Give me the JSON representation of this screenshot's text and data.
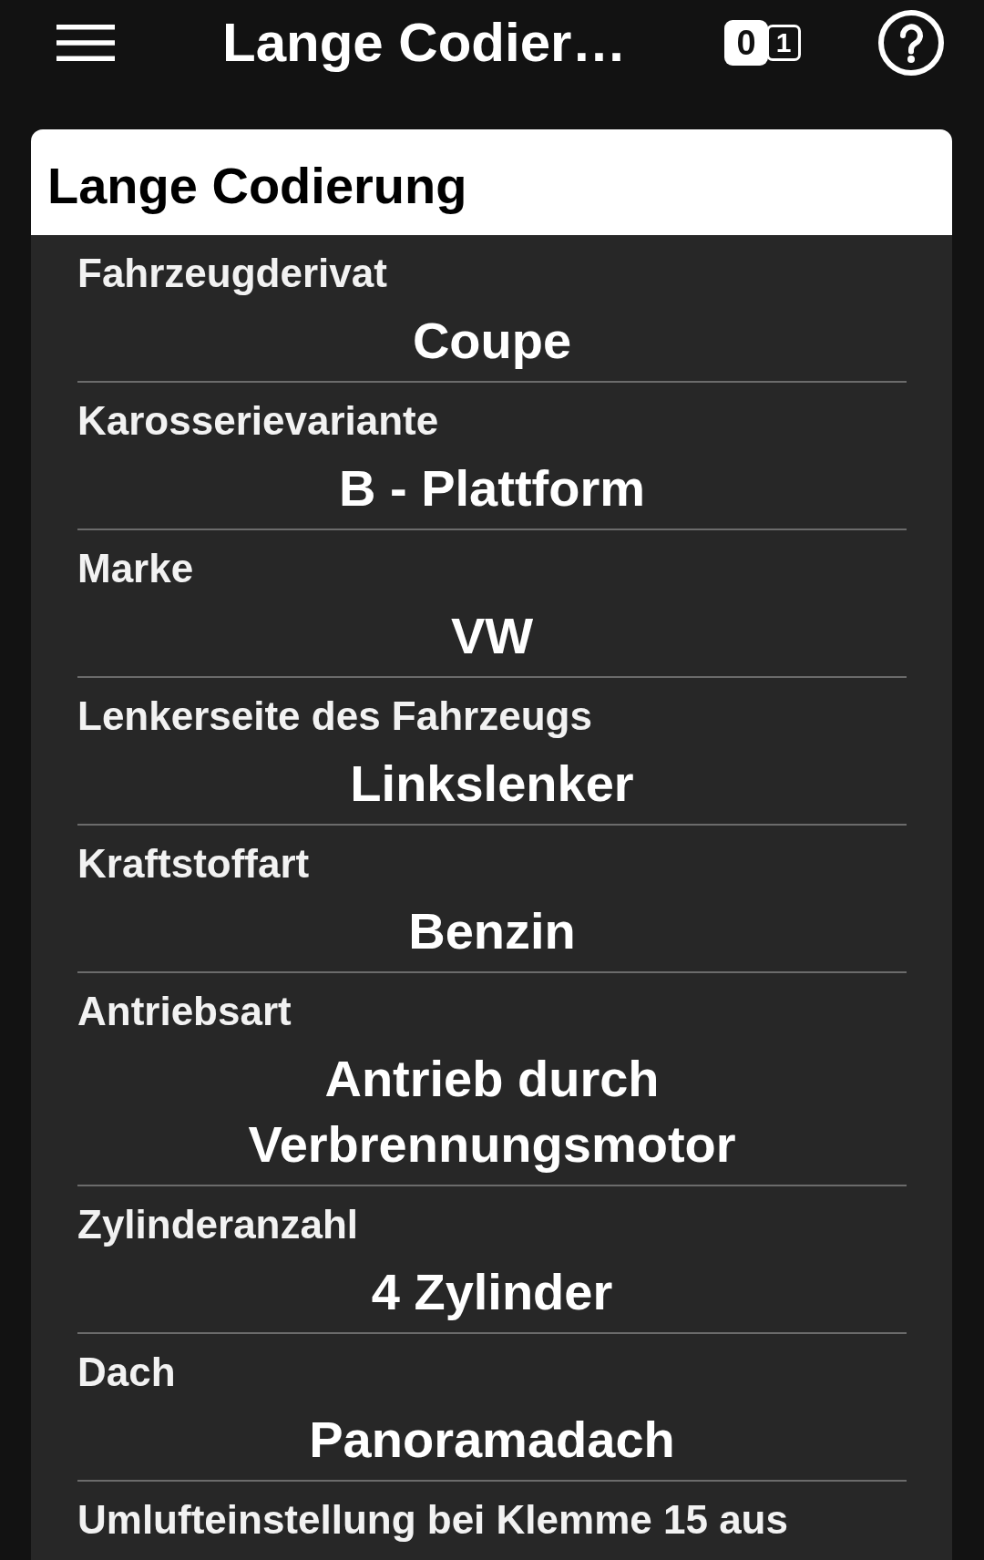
{
  "app_bar": {
    "title": "Lange Codier…",
    "bit_toggle": [
      {
        "label": "0",
        "selected": true
      },
      {
        "label": "1",
        "selected": false
      }
    ]
  },
  "card": {
    "title": "Lange Codierung",
    "parameters": [
      {
        "parameter": "Fahrzeugderivat",
        "option": "Coupe"
      },
      {
        "parameter": "Karosserievariante",
        "option": "B - Plattform"
      },
      {
        "parameter": "Marke",
        "option": "VW"
      },
      {
        "parameter": "Lenkerseite des Fahrzeugs",
        "option": "Linkslenker"
      },
      {
        "parameter": "Kraftstoffart",
        "option": "Benzin"
      },
      {
        "parameter": "Antriebsart",
        "option": "Antrieb durch Verbrennungsmotor"
      },
      {
        "parameter": "Zylinderanzahl",
        "option": "4 Zylinder"
      },
      {
        "parameter": "Dach",
        "option": "Panoramadach"
      },
      {
        "parameter": "Umlufteinstellung bei Klemme 15 aus"
      }
    ]
  }
}
